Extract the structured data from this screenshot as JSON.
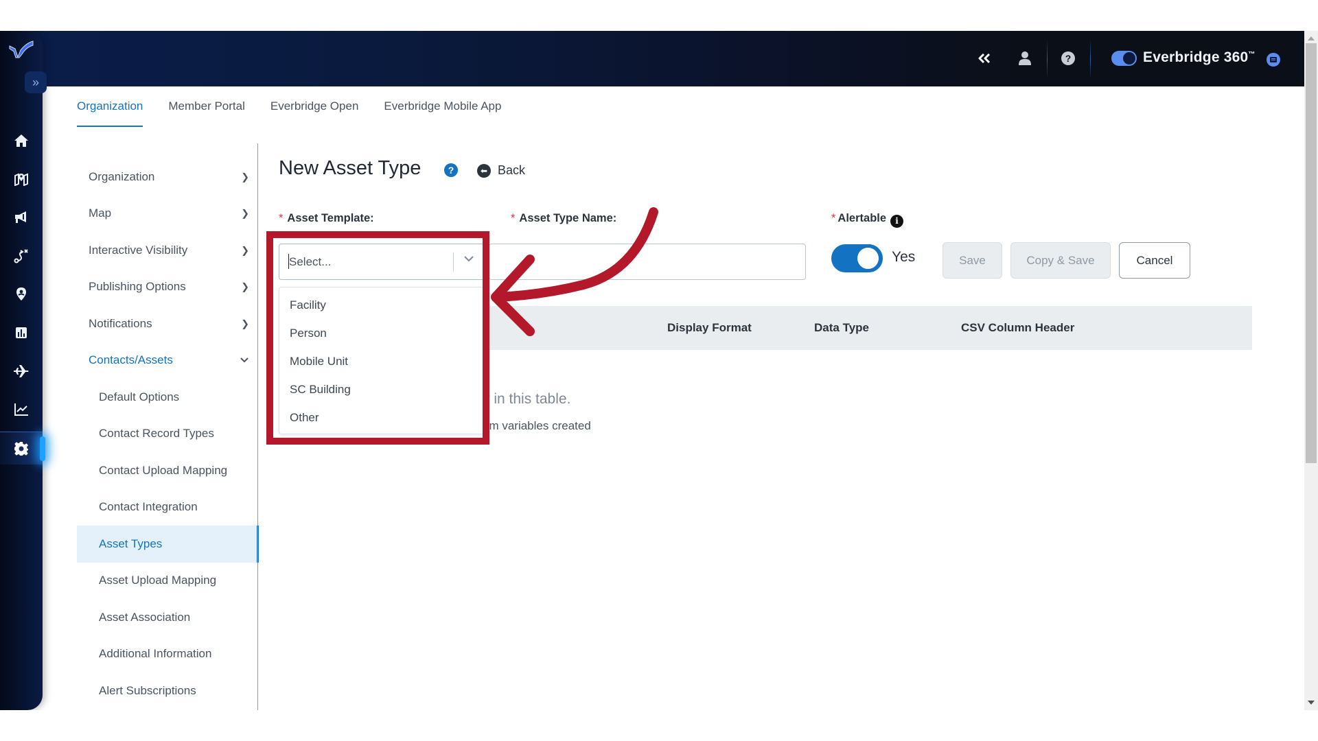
{
  "header": {
    "collapse_icon": "double-chevron-left-icon",
    "user_icon": "user-icon",
    "help_icon": "question-circle-icon",
    "brand_toggle_on": true,
    "brand_name": "Everbridge 360",
    "brand_mark": "™",
    "chat_icon": "chat-icon"
  },
  "rail": {
    "logo": "everbridge-logo",
    "expand_icon": "»",
    "items": [
      {
        "name": "home",
        "icon": "home-icon"
      },
      {
        "name": "map",
        "icon": "map-icon"
      },
      {
        "name": "communications",
        "icon": "megaphone-icon"
      },
      {
        "name": "incidents",
        "icon": "route-icon"
      },
      {
        "name": "locations",
        "icon": "map-pin-icon"
      },
      {
        "name": "reports",
        "icon": "bar-chart-icon"
      },
      {
        "name": "travel",
        "icon": "airplane-icon"
      },
      {
        "name": "analytics",
        "icon": "line-chart-icon"
      },
      {
        "name": "settings",
        "icon": "gear-icon",
        "active": true
      }
    ]
  },
  "tabs": [
    {
      "label": "Organization",
      "active": true
    },
    {
      "label": "Member Portal"
    },
    {
      "label": "Everbridge Open"
    },
    {
      "label": "Everbridge Mobile App"
    }
  ],
  "sidemenu": {
    "items": [
      {
        "label": "Organization",
        "chevron": "›"
      },
      {
        "label": "Map",
        "chevron": "›"
      },
      {
        "label": "Interactive Visibility",
        "chevron": "›"
      },
      {
        "label": "Publishing Options",
        "chevron": "›"
      },
      {
        "label": "Notifications",
        "chevron": "›"
      },
      {
        "label": "Contacts/Assets",
        "chevron": "⌄",
        "open": true
      }
    ],
    "subitems": [
      {
        "label": "Default Options"
      },
      {
        "label": "Contact Record Types"
      },
      {
        "label": "Contact Upload Mapping"
      },
      {
        "label": "Contact Integration"
      },
      {
        "label": "Asset Types",
        "selected": true
      },
      {
        "label": "Asset Upload Mapping"
      },
      {
        "label": "Asset Association"
      },
      {
        "label": "Additional Information"
      },
      {
        "label": "Alert Subscriptions"
      }
    ]
  },
  "form": {
    "title": "New Asset Type",
    "help_glyph": "?",
    "back_label": "Back",
    "required_mark": "*",
    "asset_template": {
      "label": "Asset Template:",
      "placeholder": "Select...",
      "options": [
        "Facility",
        "Person",
        "Mobile Unit",
        "SC Building",
        "Other"
      ],
      "expanded": true
    },
    "asset_type_name": {
      "label": "Asset Type Name:",
      "value": ""
    },
    "alertable": {
      "label": "Alertable",
      "info_glyph": "i",
      "on": true,
      "state_label": "Yes"
    },
    "buttons": {
      "save": "Save",
      "copy_save": "Copy & Save",
      "cancel": "Cancel"
    }
  },
  "table": {
    "columns": [
      "Display Format",
      "Data Type",
      "CSV Column Header"
    ],
    "empty_line_1": "y in this table.",
    "empty_line_2": "om variables created"
  },
  "annotation": {
    "color": "#b3192a",
    "target": "asset-template-select"
  },
  "colors": {
    "accent": "#1373c2",
    "header_bg": "#0b0f17",
    "rail_bg": "#0a1b44",
    "required": "#d9343f"
  }
}
